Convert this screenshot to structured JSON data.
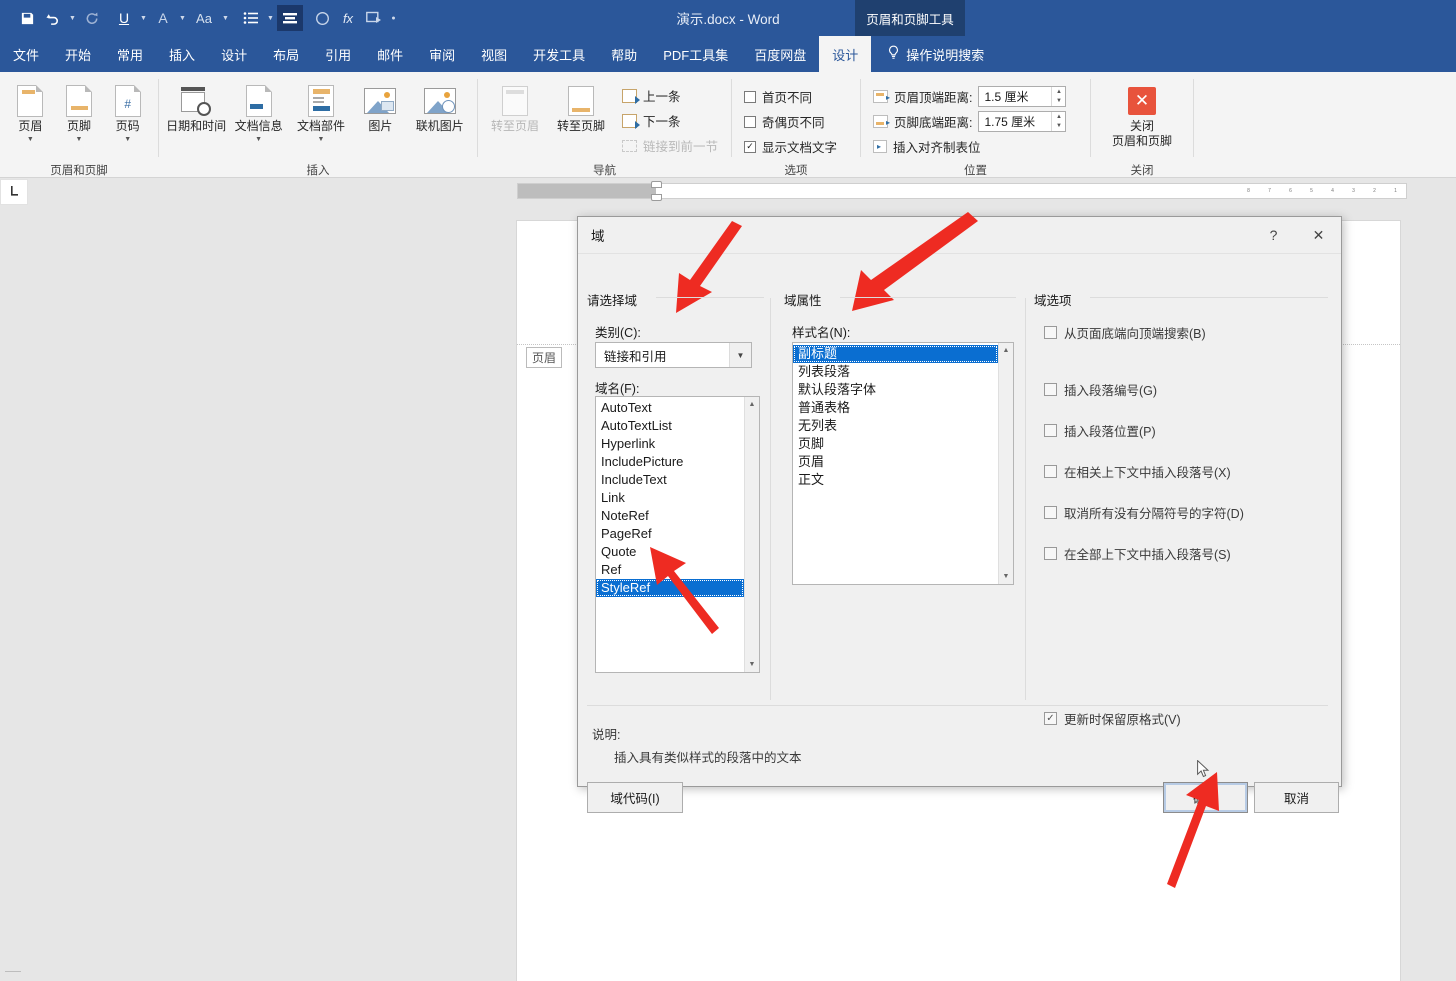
{
  "titlebar": {
    "document_title": "演示.docx - Word",
    "context_tab_title": "页眉和页脚工具",
    "qat": [
      {
        "name": "save-icon",
        "glyph": "💾"
      },
      {
        "name": "undo-icon",
        "glyph": "↶"
      },
      {
        "name": "redo-icon",
        "glyph": "↻"
      },
      {
        "name": "underline-icon",
        "glyph": "U"
      },
      {
        "name": "font-color-icon",
        "glyph": "A"
      },
      {
        "name": "change-case-icon",
        "glyph": "Aa"
      },
      {
        "name": "bullets-icon",
        "glyph": "☰"
      },
      {
        "name": "paragraph-mark-icon",
        "glyph": "≡"
      },
      {
        "name": "shape-icon",
        "glyph": "○"
      },
      {
        "name": "formula-icon",
        "glyph": "fx"
      },
      {
        "name": "screenshot-icon",
        "glyph": "⏏"
      },
      {
        "name": "customize-qat-icon",
        "glyph": "▾"
      }
    ]
  },
  "tabs": [
    {
      "label": "文件",
      "selected": false
    },
    {
      "label": "开始",
      "selected": false
    },
    {
      "label": "常用",
      "selected": false
    },
    {
      "label": "插入",
      "selected": false
    },
    {
      "label": "设计",
      "selected": false
    },
    {
      "label": "布局",
      "selected": false
    },
    {
      "label": "引用",
      "selected": false
    },
    {
      "label": "邮件",
      "selected": false
    },
    {
      "label": "审阅",
      "selected": false
    },
    {
      "label": "视图",
      "selected": false
    },
    {
      "label": "开发工具",
      "selected": false
    },
    {
      "label": "帮助",
      "selected": false
    },
    {
      "label": "PDF工具集",
      "selected": false
    },
    {
      "label": "百度网盘",
      "selected": false
    },
    {
      "label": "设计",
      "selected": true
    }
  ],
  "tell_me": "操作说明搜索",
  "ribbon": {
    "groups": [
      {
        "label": "页眉和页脚",
        "buttons": [
          {
            "label": "页眉",
            "icon": "header-icon",
            "caret": true
          },
          {
            "label": "页脚",
            "icon": "footer-icon",
            "caret": true
          },
          {
            "label": "页码",
            "icon": "page-number-icon",
            "caret": true
          }
        ]
      },
      {
        "label": "插入",
        "buttons": [
          {
            "label": "日期和时间",
            "icon": "date-time-icon",
            "caret": false
          },
          {
            "label": "文档信息",
            "icon": "doc-info-icon",
            "caret": true
          },
          {
            "label": "文档部件",
            "icon": "quick-parts-icon",
            "caret": true
          },
          {
            "label": "图片",
            "icon": "picture-icon",
            "caret": false
          },
          {
            "label": "联机图片",
            "icon": "online-picture-icon",
            "caret": false
          }
        ]
      },
      {
        "label": "导航",
        "buttons": [
          {
            "label": "转至页眉",
            "icon": "goto-header-icon",
            "disabled": true
          },
          {
            "label": "转至页脚",
            "icon": "goto-footer-icon",
            "disabled": false
          }
        ],
        "small_items": [
          {
            "label": "上一条",
            "icon": "previous-icon",
            "disabled": false
          },
          {
            "label": "下一条",
            "icon": "next-icon",
            "disabled": false
          },
          {
            "label": "链接到前一节",
            "icon": "link-to-previous-icon",
            "disabled": true
          }
        ]
      },
      {
        "label": "选项",
        "checks": [
          {
            "label": "首页不同",
            "checked": false
          },
          {
            "label": "奇偶页不同",
            "checked": false
          },
          {
            "label": "显示文档文字",
            "checked": true
          }
        ]
      },
      {
        "label": "位置",
        "spinners": [
          {
            "label": "页眉顶端距离:",
            "value": "1.5 厘米",
            "icon": "header-from-top-icon"
          },
          {
            "label": "页脚底端距离:",
            "value": "1.75 厘米",
            "icon": "footer-from-bottom-icon"
          }
        ],
        "action": {
          "label": "插入对齐制表位",
          "icon": "align-tab-icon"
        }
      },
      {
        "label": "关闭",
        "close_button": {
          "line1": "关闭",
          "line2": "页眉和页脚",
          "icon": "close-header-footer-icon"
        }
      }
    ]
  },
  "document": {
    "header_tag": "页眉",
    "ruler_corner_icon": "tab-stop-left-icon"
  },
  "dialog": {
    "title": "域",
    "help_icon": "?",
    "close_icon": "✕",
    "left": {
      "group_label": "请选择域",
      "category_label": "类别(C):",
      "category_value": "链接和引用",
      "fieldname_label": "域名(F):",
      "field_names": [
        "AutoText",
        "AutoTextList",
        "Hyperlink",
        "IncludePicture",
        "IncludeText",
        "Link",
        "NoteRef",
        "PageRef",
        "Quote",
        "Ref",
        "StyleRef"
      ],
      "selected_field": "StyleRef"
    },
    "middle": {
      "group_label": "域属性",
      "stylename_label": "样式名(N):",
      "style_names": [
        "副标题",
        "列表段落",
        "默认段落字体",
        "普通表格",
        "无列表",
        "页脚",
        "页眉",
        "正文"
      ],
      "selected_style": "副标题"
    },
    "right": {
      "group_label": "域选项",
      "options": [
        {
          "label": "从页面底端向顶端搜索(B)",
          "checked": false
        },
        {
          "label": "插入段落编号(G)",
          "checked": false
        },
        {
          "label": "插入段落位置(P)",
          "checked": false
        },
        {
          "label": "在相关上下文中插入段落号(X)",
          "checked": false
        },
        {
          "label": "取消所有没有分隔符号的字符(D)",
          "checked": false
        },
        {
          "label": "在全部上下文中插入段落号(S)",
          "checked": false
        }
      ],
      "preserve": {
        "label": "更新时保留原格式(V)",
        "checked": true
      }
    },
    "description_label": "说明:",
    "description_text": "插入具有类似样式的段落中的文本",
    "field_codes_button": "域代码(I)",
    "ok_button": "确定",
    "cancel_button": "取消"
  },
  "colors": {
    "word_blue": "#2b579a",
    "ribbon_bg": "#f4f4f4",
    "selection_blue": "#0a6ed1",
    "annotation_red": "#ee2b22",
    "close_red": "#e8533c"
  }
}
